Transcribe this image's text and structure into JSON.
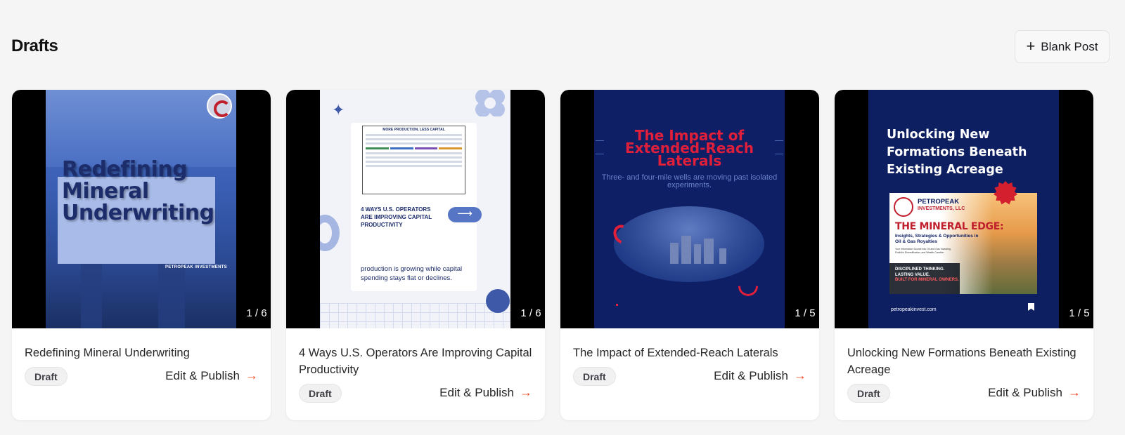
{
  "header": {
    "title": "Drafts",
    "blank_post_label": "Blank Post"
  },
  "cards": [
    {
      "title": "Redefining Mineral Underwriting",
      "slide_counter": "1 / 6",
      "status": "Draft",
      "action": "Edit & Publish",
      "thumbnail": {
        "headline": "Redefining Mineral Underwriting",
        "brand": "PETROPEAK INVESTMENTS"
      }
    },
    {
      "title": "4 Ways U.S. Operators Are Improving Capital Productivity",
      "slide_counter": "1 / 6",
      "status": "Draft",
      "action": "Edit & Publish",
      "thumbnail": {
        "doc_title": "MORE PRODUCTION, LESS CAPITAL",
        "headline": "4 WAYS U.S. OPERATORS ARE IMPROVING CAPITAL PRODUCTIVITY",
        "body": "production is growing while capital spending stays flat or declines."
      }
    },
    {
      "title": "The Impact of Extended-Reach Laterals",
      "slide_counter": "1 / 5",
      "status": "Draft",
      "action": "Edit & Publish",
      "thumbnail": {
        "headline": "The Impact of Extended-Reach Laterals",
        "subtitle": "Three- and four-mile wells are moving past isolated experiments."
      }
    },
    {
      "title": "Unlocking New Formations Beneath Existing Acreage",
      "slide_counter": "1 / 5",
      "status": "Draft",
      "action": "Edit & Publish",
      "thumbnail": {
        "headline": "Unlocking New Formations Beneath Existing Acreage",
        "brand_line1": "PETROPEAK",
        "brand_line2": "INVESTMENTS, LLC",
        "feature_title": "THE MINERAL EDGE:",
        "feature_sub": "Insights, Strategies & Opportunities in Oil & Gas Royalties",
        "fine_print": "Your Information Source into Oil and Gas Investing, Portfolio Diversification, and Wealth Creation",
        "tag1": "DISCIPLINED THINKING.",
        "tag2": "LASTING VALUE.",
        "tag3": "BUILT FOR MINERAL OWNERS.",
        "url": "petropeakinvest.com"
      }
    }
  ],
  "icons": {
    "plus": "plus-icon",
    "arrow": "arrow-right-icon",
    "bookmark": "bookmark-icon"
  },
  "colors": {
    "accent": "#ef4a25",
    "background": "#f5f5f6",
    "card": "#ffffff",
    "slide_navy": "#0e1f66",
    "slide_red": "#e01f3a"
  }
}
